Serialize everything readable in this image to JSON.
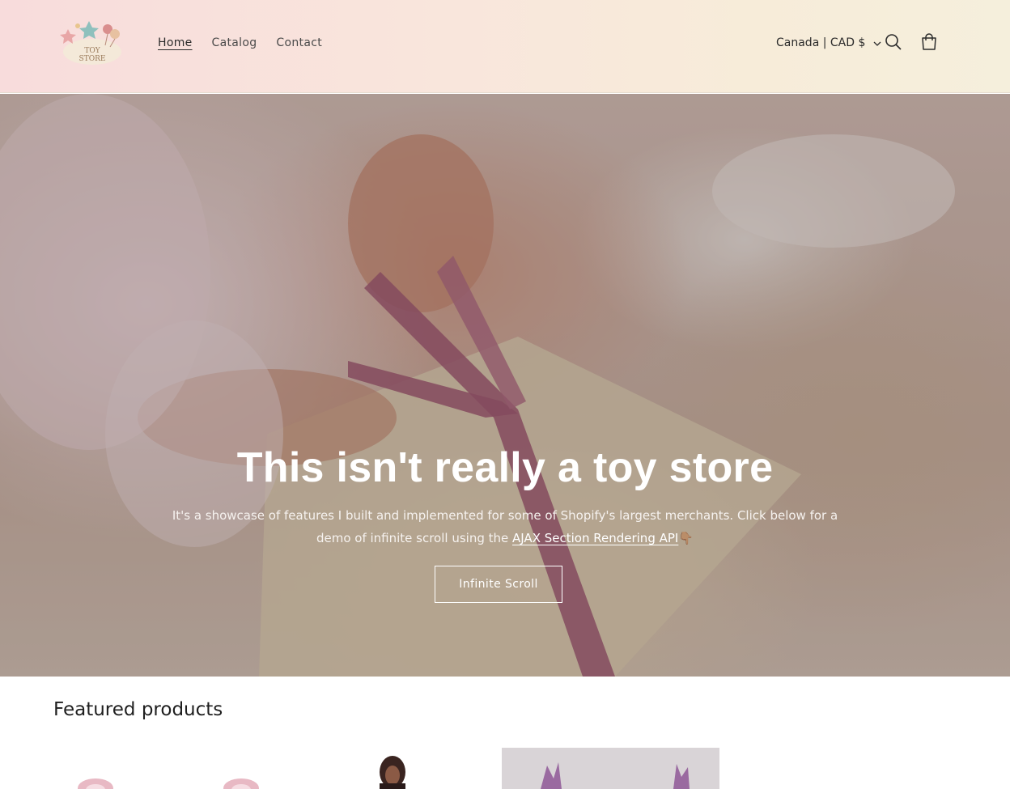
{
  "header": {
    "logo_text_line1": "TOY",
    "logo_text_line2": "STORE",
    "nav": [
      {
        "label": "Home",
        "active": true
      },
      {
        "label": "Catalog",
        "active": false
      },
      {
        "label": "Contact",
        "active": false
      }
    ],
    "country_selector": "Canada | CAD $",
    "icons": {
      "search": "search-icon",
      "cart": "cart-icon",
      "chevron": "chevron-down-icon"
    }
  },
  "hero": {
    "title": "This isn't really a toy store",
    "text_before_link": "It's a showcase of features I built and implemented for some of Shopify's largest merchants. Click below for a demo of infinite scroll using the ",
    "link_text": "AJAX Section Rendering API",
    "emoji": "👇🏽",
    "button_label": "Infinite Scroll"
  },
  "featured": {
    "title": "Featured products"
  },
  "colors": {
    "header_gradient_start": "#f8dcdc",
    "header_gradient_end": "#f5efdc",
    "ribbon": "#a05873",
    "text_dark": "#121212"
  }
}
